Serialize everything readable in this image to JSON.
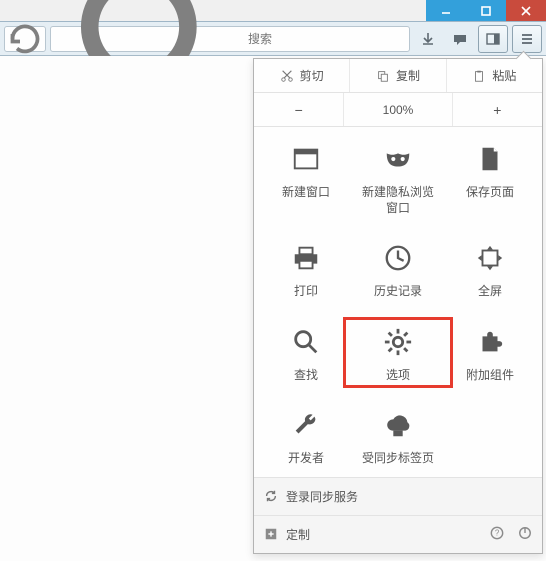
{
  "search": {
    "placeholder": "搜索"
  },
  "zoom": {
    "level": "100%"
  },
  "edit": {
    "cut": "剪切",
    "copy": "复制",
    "paste": "粘贴"
  },
  "grid": {
    "new_window": "新建窗口",
    "new_private": "新建隐私浏览窗口",
    "save_page": "保存页面",
    "print": "打印",
    "history": "历史记录",
    "fullscreen": "全屏",
    "find": "查找",
    "options": "选项",
    "addons": "附加组件",
    "developer": "开发者",
    "synced_tabs": "受同步标签页"
  },
  "footer": {
    "sync": "登录同步服务",
    "customize": "定制"
  }
}
